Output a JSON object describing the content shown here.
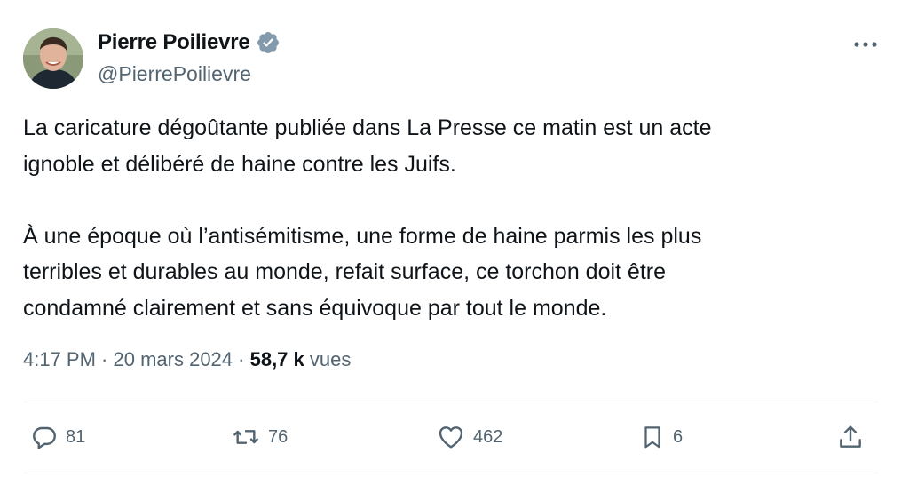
{
  "author": {
    "display_name": "Pierre Poilievre",
    "handle": "@PierrePoilievre"
  },
  "tweet": {
    "paragraph1_line1": "La caricature dégoûtante publiée dans La Presse ce matin est un acte",
    "paragraph1_line2": "ignoble et délibéré de haine contre les Juifs.",
    "paragraph2_line1": "À une époque où l’antisémitisme, une forme de haine parmis les plus",
    "paragraph2_line2": "terribles et durables au monde, refait surface, ce torchon doit être",
    "paragraph2_line3": "condamné clairement et sans équivoque par tout le monde."
  },
  "meta": {
    "time": "4:17 PM",
    "separator1": " · ",
    "date": "20 mars 2024",
    "separator2": " · ",
    "views_count": "58,7 k",
    "views_label": " vues"
  },
  "actions": {
    "replies": "81",
    "reposts": "76",
    "likes": "462",
    "bookmarks": "6"
  },
  "icons": {
    "verified": "verified-badge-icon",
    "more": "more-icon",
    "reply": "reply-icon",
    "repost": "repost-icon",
    "like": "heart-icon",
    "bookmark": "bookmark-icon",
    "share": "share-icon"
  },
  "colors": {
    "text_primary": "#0f1419",
    "text_secondary": "#536471",
    "verified_badge": "#829aab",
    "divider": "#eff3f4"
  }
}
